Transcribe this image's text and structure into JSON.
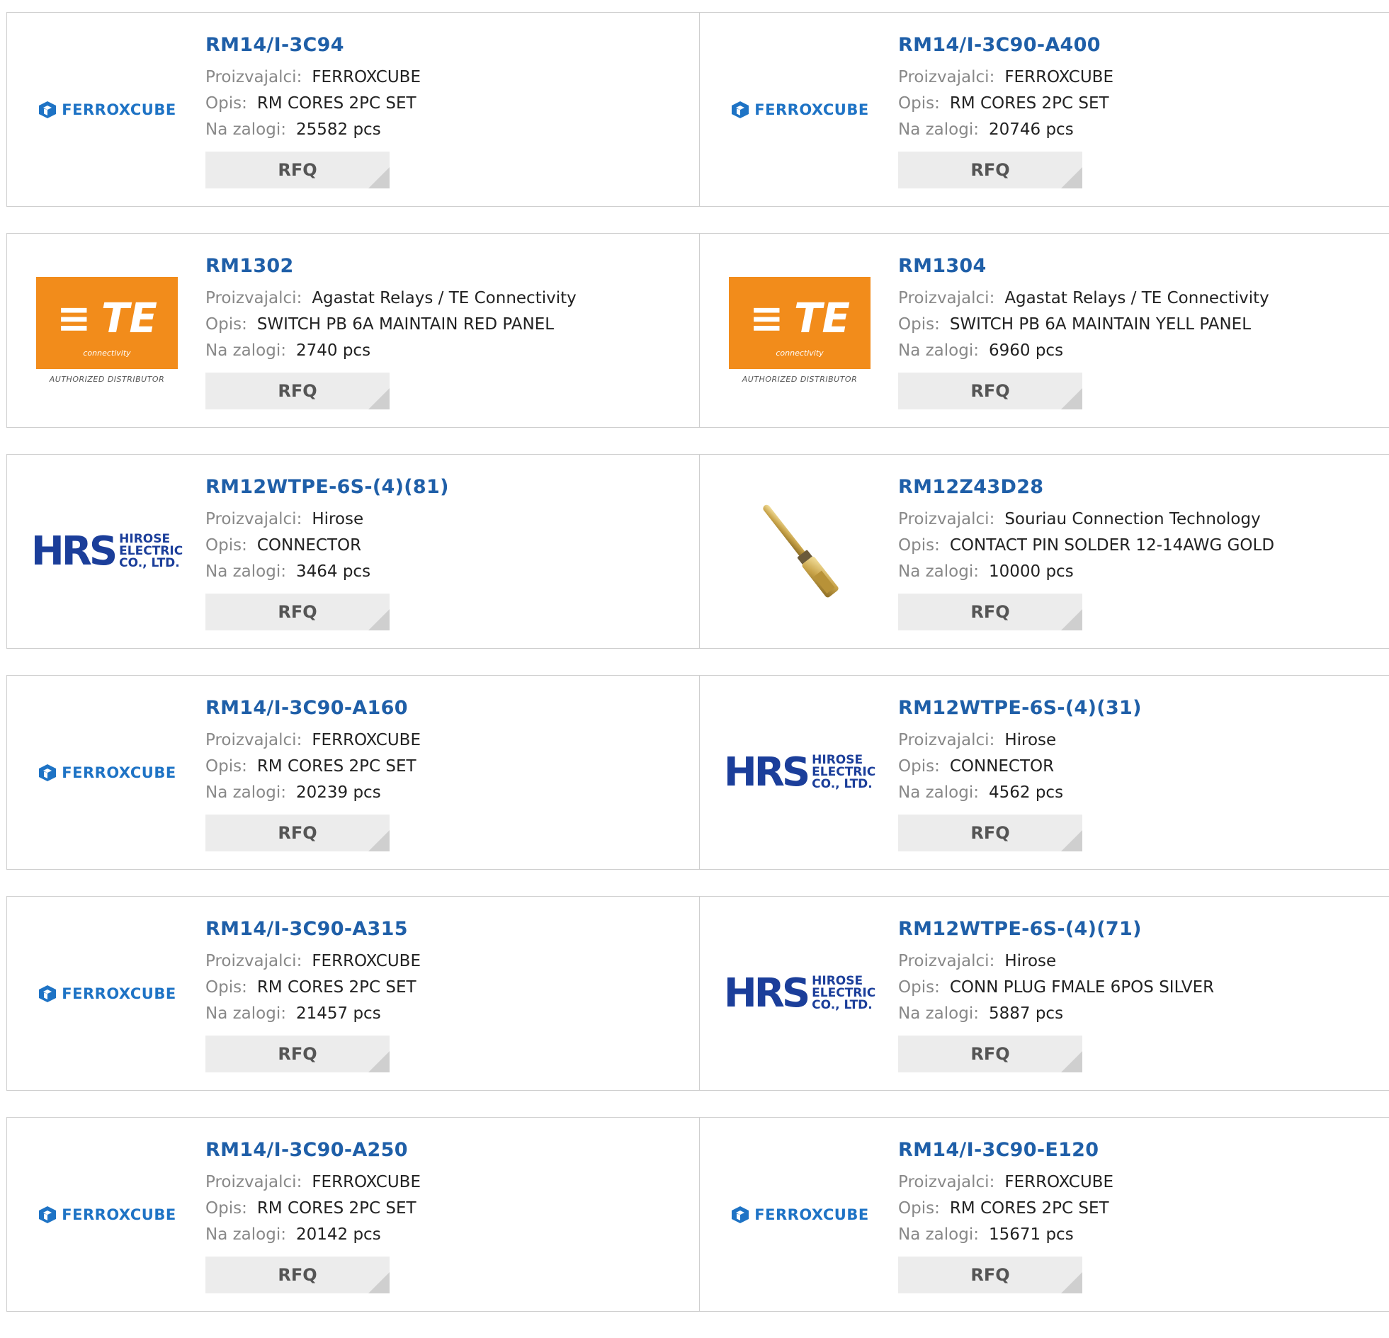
{
  "labels": {
    "manufacturer": "Proizvajalci:",
    "description": "Opis:",
    "stock": "Na zalogi:",
    "rfq": "RFQ"
  },
  "logos": {
    "ferroxcube": "FERROXCUBE",
    "te_letters": "TE",
    "te_sub": "connectivity",
    "te_authorized": "AUTHORIZED DISTRIBUTOR",
    "hrs_big": "HRS",
    "hrs_line1": "HIROSE",
    "hrs_line2": "ELECTRIC",
    "hrs_line3": "CO., LTD."
  },
  "colors": {
    "title": "#1f5fa8",
    "ferroxcube": "#1e73c5",
    "te_orange": "#f28c1b",
    "hrs_blue": "#1b3e9a"
  },
  "products": [
    {
      "part": "RM14/I-3C94",
      "manufacturer": "FERROXCUBE",
      "description": "RM CORES 2PC SET",
      "stock": "25582 pcs",
      "logo": "ferroxcube-logo"
    },
    {
      "part": "RM14/I-3C90-A400",
      "manufacturer": "FERROXCUBE",
      "description": "RM CORES 2PC SET",
      "stock": "20746 pcs",
      "logo": "ferroxcube-logo"
    },
    {
      "part": "RM1302",
      "manufacturer": "Agastat Relays / TE Connectivity",
      "description": "SWITCH PB 6A MAINTAIN RED PANEL",
      "stock": "2740 pcs",
      "logo": "te-connectivity-logo"
    },
    {
      "part": "RM1304",
      "manufacturer": "Agastat Relays / TE Connectivity",
      "description": "SWITCH PB 6A MAINTAIN YELL PANEL",
      "stock": "6960 pcs",
      "logo": "te-connectivity-logo"
    },
    {
      "part": "RM12WTPE-6S-(4)(81)",
      "manufacturer": "Hirose",
      "description": "CONNECTOR",
      "stock": "3464 pcs",
      "logo": "hirose-logo"
    },
    {
      "part": "RM12Z43D28",
      "manufacturer": "Souriau Connection Technology",
      "description": "CONTACT PIN SOLDER 12-14AWG GOLD",
      "stock": "10000 pcs",
      "logo": "contact-pin-image"
    },
    {
      "part": "RM14/I-3C90-A160",
      "manufacturer": "FERROXCUBE",
      "description": "RM CORES 2PC SET",
      "stock": "20239 pcs",
      "logo": "ferroxcube-logo"
    },
    {
      "part": "RM12WTPE-6S-(4)(31)",
      "manufacturer": "Hirose",
      "description": "CONNECTOR",
      "stock": "4562 pcs",
      "logo": "hirose-logo"
    },
    {
      "part": "RM14/I-3C90-A315",
      "manufacturer": "FERROXCUBE",
      "description": "RM CORES 2PC SET",
      "stock": "21457 pcs",
      "logo": "ferroxcube-logo"
    },
    {
      "part": "RM12WTPE-6S-(4)(71)",
      "manufacturer": "Hirose",
      "description": "CONN PLUG FMALE 6POS SILVER",
      "stock": "5887 pcs",
      "logo": "hirose-logo"
    },
    {
      "part": "RM14/I-3C90-A250",
      "manufacturer": "FERROXCUBE",
      "description": "RM CORES 2PC SET",
      "stock": "20142 pcs",
      "logo": "ferroxcube-logo"
    },
    {
      "part": "RM14/I-3C90-E120",
      "manufacturer": "FERROXCUBE",
      "description": "RM CORES 2PC SET",
      "stock": "15671 pcs",
      "logo": "ferroxcube-logo"
    }
  ]
}
